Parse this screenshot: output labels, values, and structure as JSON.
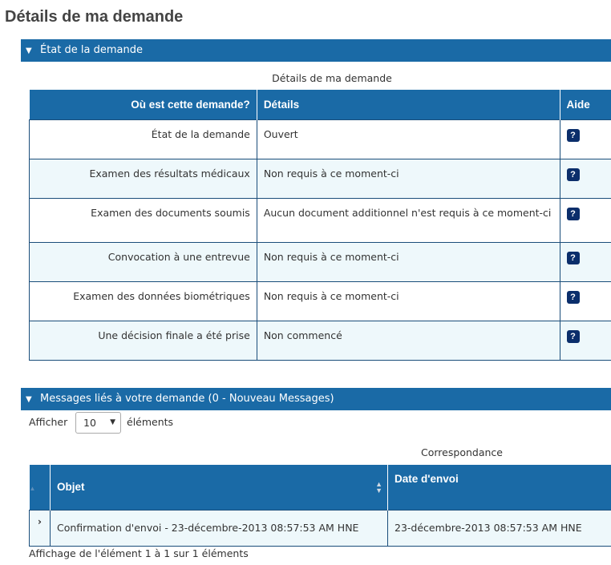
{
  "page_title": "Détails de ma demande",
  "status_section": {
    "header": "État de la demande",
    "caption": "Détails de ma demande",
    "columns": [
      "Où est cette demande?",
      "Détails",
      "Aide"
    ],
    "rows": [
      {
        "step": "État de la demande",
        "detail": "Ouvert",
        "help": "?"
      },
      {
        "step": "Examen des résultats médicaux",
        "detail": "Non requis à ce moment-ci",
        "help": "?"
      },
      {
        "step": "Examen des documents soumis",
        "detail": "Aucun document additionnel n'est requis à ce moment-ci",
        "help": "?"
      },
      {
        "step": "Convocation à une entrevue",
        "detail": "Non requis à ce moment-ci",
        "help": "?"
      },
      {
        "step": "Examen des données biométriques",
        "detail": "Non requis à ce moment-ci",
        "help": "?"
      },
      {
        "step": "Une décision finale a été prise",
        "detail": "Non commencé",
        "help": "?"
      }
    ]
  },
  "messages_section": {
    "header": "Messages liés à votre demande (0 - Nouveau Messages)",
    "show_label": "Afficher",
    "show_value": "10",
    "show_suffix": "éléments",
    "caption": "Correspondance",
    "columns": [
      "Objet",
      "Date d'envoi"
    ],
    "rows": [
      {
        "subject": "Confirmation d'envoi - 23-décembre-2013 08:57:53 AM HNE",
        "date": "23-décembre-2013 08:57:53 AM HNE"
      }
    ],
    "info": "Affichage de l'élément 1 à 1 sur 1 éléments"
  },
  "icons": {
    "collapse": "triangle-down-icon",
    "expand_row": "chevron-right-icon",
    "sort": "sort-icon",
    "help": "help-icon"
  },
  "colors": {
    "header_bg": "#1a6aa6",
    "row_alt_bg": "#eef8fb",
    "help_icon_bg": "#0b2e6b"
  }
}
